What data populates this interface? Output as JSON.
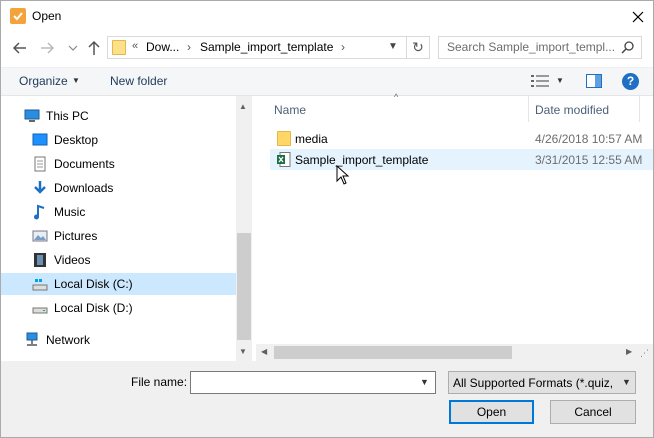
{
  "window": {
    "title": "Open"
  },
  "address": {
    "overflow_chevron": "«",
    "segments": [
      "Dow...",
      "Sample_import_template"
    ],
    "separator": "›"
  },
  "search": {
    "placeholder": "Search Sample_import_templ..."
  },
  "toolbar": {
    "organize_label": "Organize",
    "new_folder_label": "New folder"
  },
  "nav": {
    "items": [
      {
        "label": "This PC",
        "icon": "computer-icon",
        "level": "top"
      },
      {
        "label": "Desktop",
        "icon": "desktop-icon",
        "level": "child"
      },
      {
        "label": "Documents",
        "icon": "documents-icon",
        "level": "child"
      },
      {
        "label": "Downloads",
        "icon": "downloads-icon",
        "level": "child"
      },
      {
        "label": "Music",
        "icon": "music-icon",
        "level": "child"
      },
      {
        "label": "Pictures",
        "icon": "pictures-icon",
        "level": "child"
      },
      {
        "label": "Videos",
        "icon": "videos-icon",
        "level": "child"
      },
      {
        "label": "Local Disk (C:)",
        "icon": "drive-c-icon",
        "level": "child",
        "selected": true
      },
      {
        "label": "Local Disk (D:)",
        "icon": "drive-d-icon",
        "level": "child"
      },
      {
        "label": "Network",
        "icon": "network-icon",
        "level": "top"
      }
    ]
  },
  "files": {
    "columns": {
      "name": "Name",
      "date": "Date modified"
    },
    "rows": [
      {
        "name": "media",
        "date": "4/26/2018 10:57 AM",
        "icon": "folder-icon"
      },
      {
        "name": "Sample_import_template",
        "date": "3/31/2015 12:55 AM",
        "icon": "excel-file-icon"
      }
    ]
  },
  "bottom": {
    "file_name_label": "File name:",
    "file_name_value": "",
    "filter_value": "All Supported Formats (*.quiz, *",
    "open_label": "Open",
    "cancel_label": "Cancel"
  },
  "colors": {
    "accent": "#0078d7",
    "selection": "#cce8ff",
    "hover": "#e5f3ff",
    "help": "#1f6fc5"
  }
}
